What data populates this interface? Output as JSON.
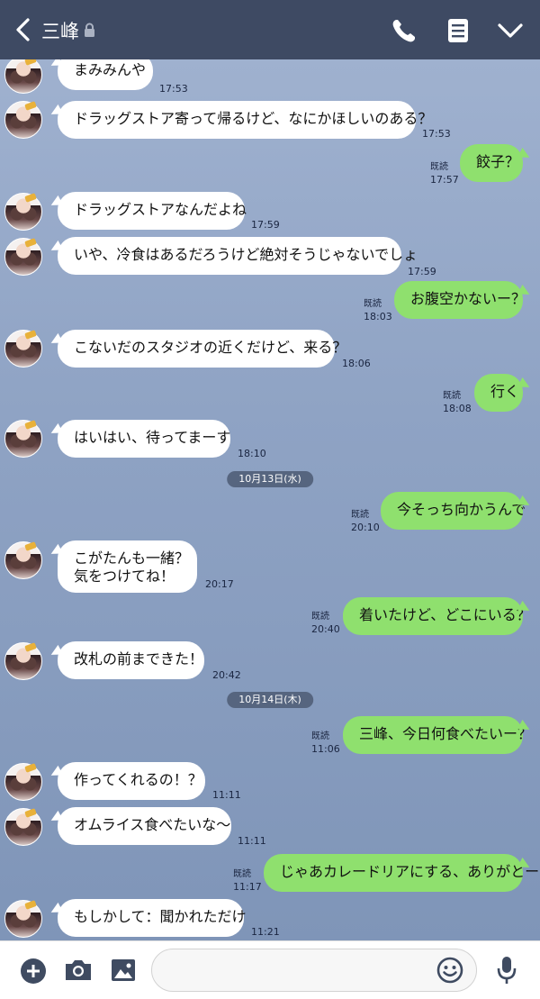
{
  "header": {
    "title": "三峰"
  },
  "icons": {
    "back": "chevron-left-icon",
    "lock": "lock-icon",
    "call": "phone-icon",
    "menu": "list-menu-icon",
    "expand": "chevron-down-icon",
    "add": "plus-circle-icon",
    "camera": "camera-icon",
    "image": "image-icon",
    "emoji": "smiley-icon",
    "mic": "microphone-icon"
  },
  "colors": {
    "header": "#3e4a63",
    "outgoing_bubble": "#8fe06e",
    "incoming_bubble": "#ffffff",
    "date_pill": "#56657f"
  },
  "messages": [
    {
      "side": "in",
      "text": "まみみんや",
      "time": "17:53"
    },
    {
      "side": "in",
      "text": "ドラッグストア寄って帰るけど、なにかほしいのある？",
      "time": "17:53"
    },
    {
      "side": "out",
      "text": "餃子？",
      "time": "17:57",
      "read": "既読"
    },
    {
      "side": "in",
      "text": "ドラッグストアなんだよね",
      "time": "17:59"
    },
    {
      "side": "in",
      "text": "いや、冷食はあるだろうけど絶対そうじゃないでしょ",
      "time": "17:59"
    },
    {
      "side": "out",
      "text": "お腹空かないー？",
      "time": "18:03",
      "read": "既読"
    },
    {
      "side": "in",
      "text": "こないだのスタジオの近くだけど、来る？",
      "time": "18:06"
    },
    {
      "side": "out",
      "text": "行く",
      "time": "18:08",
      "read": "既読"
    },
    {
      "side": "in",
      "text": "はいはい、待ってまーす",
      "time": "18:10"
    },
    {
      "side": "date",
      "text": "10月13日(水)"
    },
    {
      "side": "out",
      "text": "今そっち向かうんで",
      "time": "20:10",
      "read": "既読"
    },
    {
      "side": "in",
      "text": "こがたんも一緒？\n気をつけてね！",
      "time": "20:17"
    },
    {
      "side": "out",
      "text": "着いたけど、どこにいる？",
      "time": "20:40",
      "read": "既読"
    },
    {
      "side": "in",
      "text": "改札の前まできた！",
      "time": "20:42"
    },
    {
      "side": "date",
      "text": "10月14日(木)"
    },
    {
      "side": "out",
      "text": "三峰、今日何食べたいー？",
      "time": "11:06",
      "read": "既読"
    },
    {
      "side": "in",
      "text": "作ってくれるの！？",
      "time": "11:11"
    },
    {
      "side": "in",
      "text": "オムライス食べたいな〜",
      "time": "11:11"
    },
    {
      "side": "out",
      "text": "じゃあカレードリアにする、ありがとー",
      "time": "11:17",
      "read": "既読"
    },
    {
      "side": "in",
      "text": "もしかして：聞かれただけ",
      "time": "11:21"
    }
  ],
  "composer": {
    "placeholder": ""
  }
}
